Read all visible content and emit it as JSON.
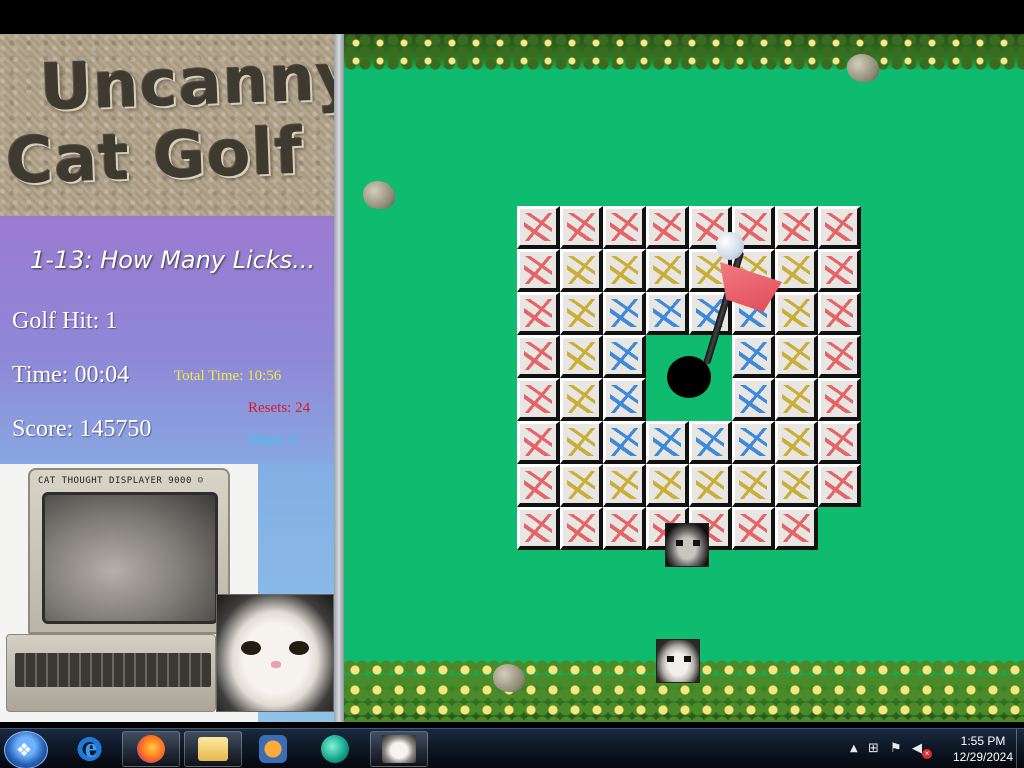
{
  "game": {
    "logo": {
      "line1": "Uncanny",
      "line2": "Cat Golf"
    },
    "level_title": "1-13: How Many Licks...",
    "golf_hit": "Golf Hit: 1",
    "time": "Time: 00:04",
    "total_time": "Total Time: 10:56",
    "resets": "Resets: 24",
    "skips": "Skips: 0",
    "score": "Score: 145750",
    "webcam": {
      "monitor_label": "CAT THOUGHT DISPLAYER 9000 ☺"
    },
    "course": {
      "tile_colors": {
        "red": "#e5565b",
        "yellow": "#c6a826",
        "blue": "#2c7fd9",
        "background": "#0ebb6f"
      },
      "grid": [
        [
          "red",
          "red",
          "red",
          "red",
          "red",
          "red",
          "red",
          "red"
        ],
        [
          "red",
          "yellow",
          "yellow",
          "yellow",
          "yellow",
          "yellow",
          "yellow",
          "red"
        ],
        [
          "red",
          "yellow",
          "blue",
          "blue",
          "blue",
          "blue",
          "yellow",
          "red"
        ],
        [
          "red",
          "yellow",
          "blue",
          "empty",
          "empty",
          "blue",
          "yellow",
          "red"
        ],
        [
          "red",
          "yellow",
          "blue",
          "empty",
          "empty",
          "blue",
          "yellow",
          "red"
        ],
        [
          "red",
          "yellow",
          "blue",
          "blue",
          "blue",
          "blue",
          "yellow",
          "red"
        ],
        [
          "red",
          "yellow",
          "yellow",
          "yellow",
          "yellow",
          "yellow",
          "yellow",
          "red"
        ],
        [
          "red",
          "red",
          "red",
          "red",
          "red",
          "red",
          "red",
          "empty"
        ]
      ]
    }
  },
  "taskbar": {
    "start_icon": "windows-logo-icon",
    "ie_glyph": "e",
    "start_glyph": "❖",
    "items": [
      {
        "name": "internet-explorer",
        "icon": "ie-icon"
      },
      {
        "name": "firefox",
        "icon": "firefox-icon"
      },
      {
        "name": "file-explorer",
        "icon": "folder-icon"
      },
      {
        "name": "media-player",
        "icon": "media-player-icon"
      },
      {
        "name": "app",
        "icon": "app-icon"
      },
      {
        "name": "uncanny-cat-golf",
        "icon": "cat-icon"
      }
    ],
    "tray": {
      "arrow": "▲",
      "network": "⊞",
      "flag": "⚑",
      "sound": "◀",
      "sound_mute": "×",
      "time": "1:55 PM",
      "date": "12/29/2024"
    }
  }
}
